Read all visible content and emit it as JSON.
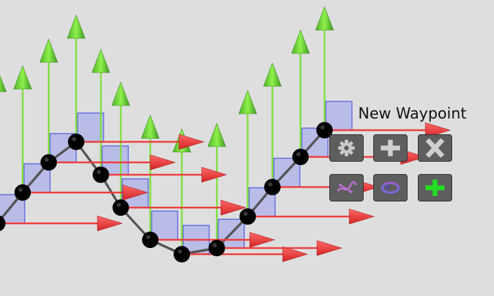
{
  "waypoint": {
    "label": "New Waypoint"
  },
  "colors": {
    "background": "#dedede",
    "up_axis": "#7fe03a",
    "forward_axis": "#ee3b3b",
    "waypoint_node": "#000000",
    "path_line": "#555555",
    "handle_plane": "#9aa0ee",
    "button_bg": "#5e5e5e",
    "add_waypoint_accent": "#22dd22"
  },
  "toolbar": {
    "row1": [
      {
        "icon": "gear-icon",
        "action": "settings"
      },
      {
        "icon": "plus-icon",
        "action": "add"
      },
      {
        "icon": "x-icon",
        "action": "delete"
      }
    ],
    "row2": [
      {
        "icon": "path-curve-icon",
        "action": "path"
      },
      {
        "icon": "orbit-icon",
        "action": "orbit"
      },
      {
        "icon": "green-plus-icon",
        "action": "add-waypoint"
      }
    ]
  }
}
